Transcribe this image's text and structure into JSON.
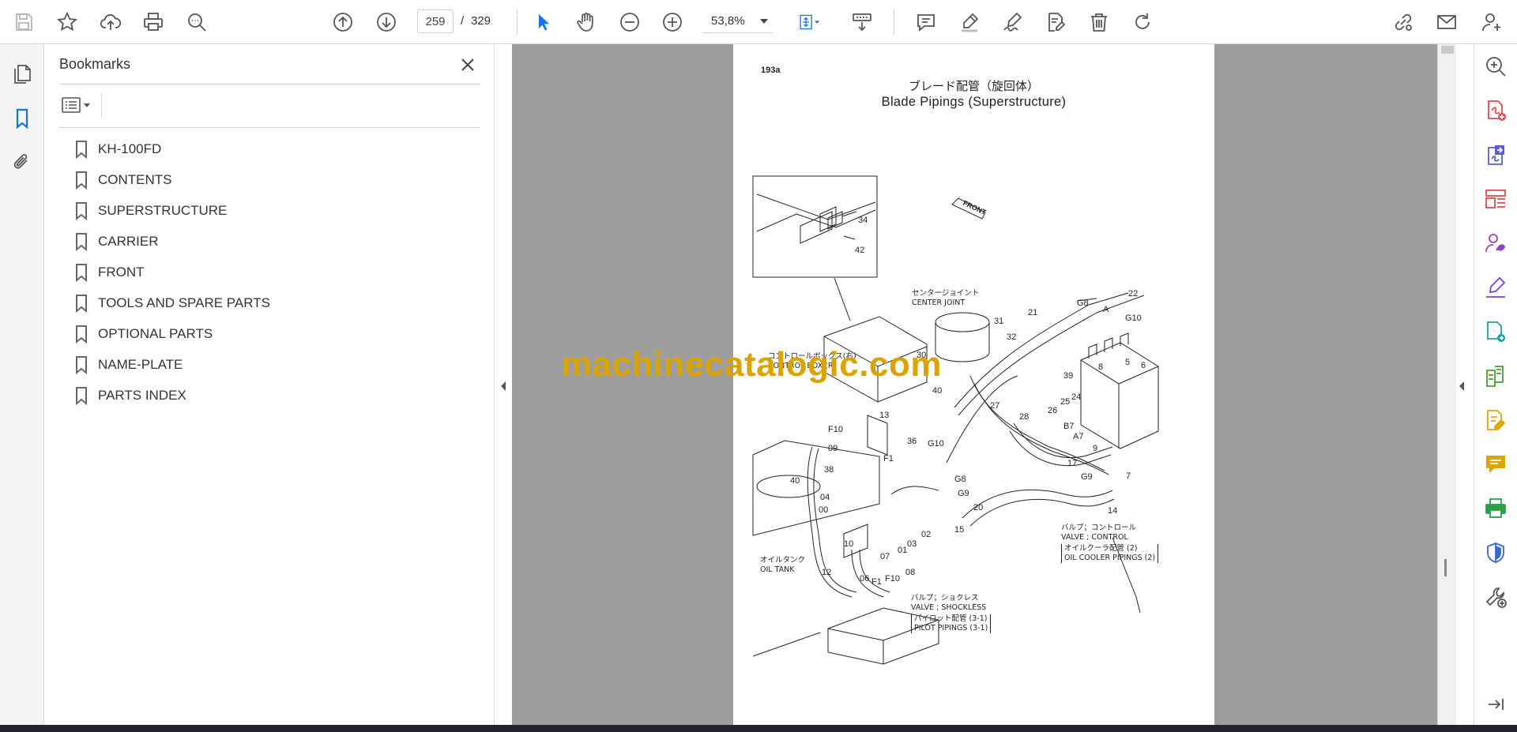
{
  "toolbar": {
    "tools": [
      {
        "name": "save-icon",
        "color": "#b5b5b5"
      },
      {
        "name": "star-icon",
        "color": "#555555"
      },
      {
        "name": "upload-cloud-icon",
        "color": "#555555"
      },
      {
        "name": "print-icon",
        "color": "#555555"
      },
      {
        "name": "search-zoom-icon",
        "color": "#555555"
      },
      {
        "name": "prev-page-icon",
        "color": "#555555"
      },
      {
        "name": "next-page-icon",
        "color": "#555555"
      },
      {
        "name": "select-arrow-icon",
        "color": "#1473e6"
      },
      {
        "name": "hand-icon",
        "color": "#555555"
      },
      {
        "name": "zoom-out-icon",
        "color": "#555555"
      },
      {
        "name": "zoom-in-icon",
        "color": "#555555"
      },
      {
        "name": "fit-page-icon",
        "color": "#1473e6"
      },
      {
        "name": "scroll-mode-icon",
        "color": "#555555"
      },
      {
        "name": "comment-icon",
        "color": "#555555"
      },
      {
        "name": "highlight-pen-icon",
        "color": "#555555"
      },
      {
        "name": "sign-icon",
        "color": "#555555"
      },
      {
        "name": "edit-icon",
        "color": "#555555"
      },
      {
        "name": "delete-icon",
        "color": "#555555"
      },
      {
        "name": "rotate-icon",
        "color": "#555555"
      },
      {
        "name": "share-link-icon",
        "color": "#555555"
      },
      {
        "name": "email-icon",
        "color": "#555555"
      },
      {
        "name": "account-icon",
        "color": "#555555"
      }
    ],
    "page_current": "259",
    "page_separator": "/",
    "page_total": "329",
    "zoom": "53,8%"
  },
  "left_rail": [
    {
      "name": "pages-icon",
      "active": false
    },
    {
      "name": "bookmark-icon",
      "active": true
    },
    {
      "name": "attachment-icon",
      "active": false
    }
  ],
  "bookmarks": {
    "title": "Bookmarks",
    "items": [
      {
        "label": "KH-100FD"
      },
      {
        "label": "CONTENTS"
      },
      {
        "label": "SUPERSTRUCTURE"
      },
      {
        "label": "CARRIER"
      },
      {
        "label": "FRONT"
      },
      {
        "label": "TOOLS AND SPARE PARTS"
      },
      {
        "label": "OPTIONAL PARTS"
      },
      {
        "label": "NAME-PLATE"
      },
      {
        "label": "PARTS INDEX"
      }
    ]
  },
  "document": {
    "page_number": "193a",
    "title_jp": "ブレード配管（旋回体）",
    "title_en": "Blade Pipings (Superstructure)",
    "watermark": "machinecatalogic.com",
    "labels": {
      "front": "FRONT",
      "center_joint_jp": "センタージョイント",
      "center_joint_en": "CENTER JOINT",
      "control_box_jp": "コントロールボックス(右)",
      "control_box_en": "CONTROL BOX (R)",
      "valve_control_jp": "バルブ；コントロール",
      "valve_control_en": "VALVE ; CONTROL",
      "oil_cooler_jp": "オイルクーラ配管 (2)",
      "oil_cooler_en": "OIL COOLER PIPINGS (2)",
      "oil_tank_jp": "オイルタンク",
      "oil_tank_en": "OIL TANK",
      "valve_shockless_jp": "バルブ；ショクレス",
      "valve_shockless_en": "VALVE ; SHOCKLESS",
      "pilot_jp": "パイロット配管 (3-1)",
      "pilot_en": "PILOT PIPINGS (3-1)"
    },
    "part_numbers": [
      "34",
      "42",
      "31",
      "32",
      "21",
      "22",
      "G8",
      "G10",
      "A",
      "30",
      "40",
      "39",
      "6",
      "8",
      "5",
      "27",
      "28",
      "26",
      "25",
      "24",
      "B7",
      "A7",
      "9",
      "17",
      "G9",
      "7",
      "14",
      "13",
      "F10",
      "09",
      "36",
      "G10",
      "F1",
      "38",
      "40",
      "04",
      "00",
      "G8",
      "G9",
      "20",
      "02",
      "03",
      "15",
      "01",
      "07",
      "10",
      "12",
      "06",
      "F1",
      "F10",
      "08"
    ]
  },
  "right_rail": [
    {
      "name": "zoom-search-icon",
      "color": "#555555"
    },
    {
      "name": "create-pdf-icon",
      "color": "#e34850"
    },
    {
      "name": "export-pdf-icon",
      "color": "#5b5bd6"
    },
    {
      "name": "organize-pages-icon",
      "color": "#e34850"
    },
    {
      "name": "request-signature-icon",
      "color": "#9b3fc7"
    },
    {
      "name": "fill-sign-icon",
      "color": "#7b3fd1"
    },
    {
      "name": "send-review-icon",
      "color": "#1aa0a0"
    },
    {
      "name": "compare-files-icon",
      "color": "#4a9e2f"
    },
    {
      "name": "edit-pdf-icon",
      "color": "#e0a500"
    },
    {
      "name": "comment-tool-icon",
      "color": "#e0a500"
    },
    {
      "name": "print-production-icon",
      "color": "#2e9e4a"
    },
    {
      "name": "protect-icon",
      "color": "#3b66d6"
    },
    {
      "name": "more-tools-icon",
      "color": "#555555"
    },
    {
      "name": "expand-panel-icon",
      "color": "#555555"
    }
  ]
}
